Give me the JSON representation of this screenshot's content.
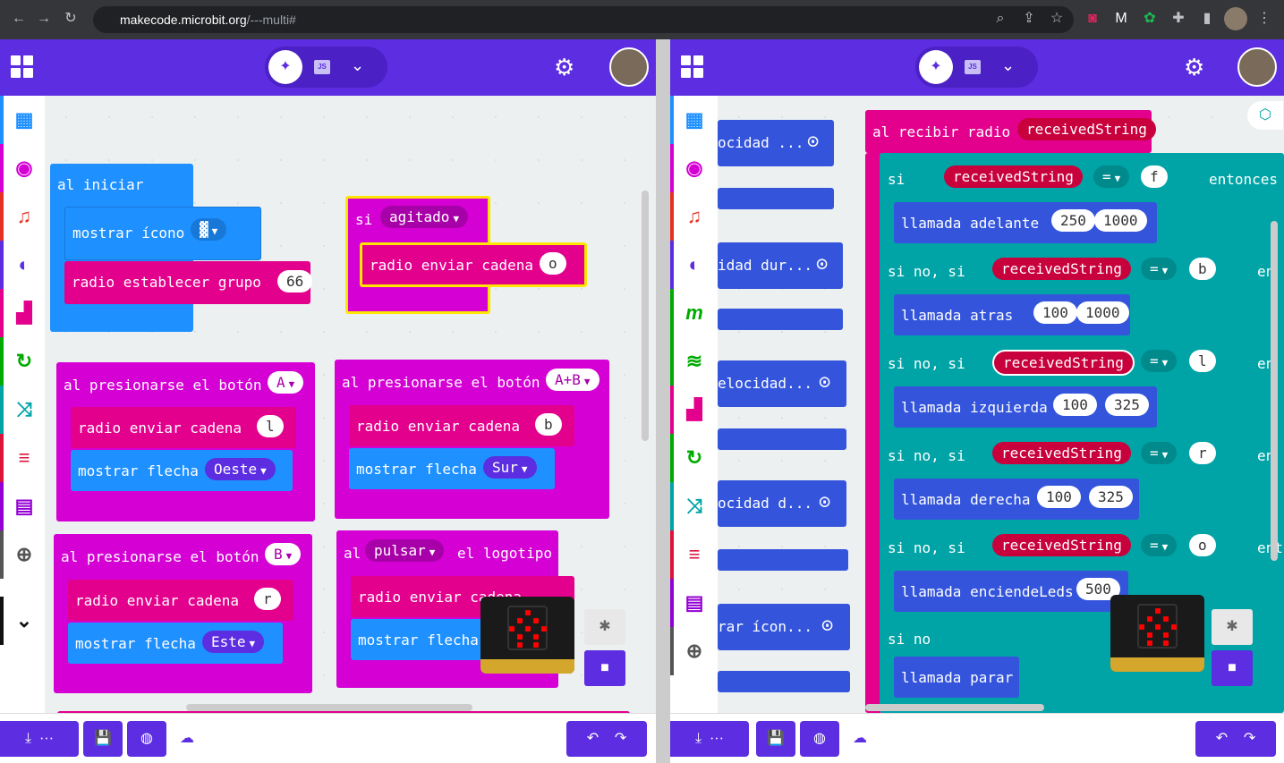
{
  "browser": {
    "url_host": "makecode.microbit.org",
    "url_path": "/---multi#"
  },
  "left": {
    "blocks": {
      "start": {
        "title": "al iniciar",
        "show_icon": "mostrar ícono",
        "set_group": "radio establecer grupo",
        "group": "66"
      },
      "shake": {
        "if": "si",
        "gesture": "agitado",
        "send": "radio enviar cadena",
        "value": "o"
      },
      "btnA": {
        "title": "al presionarse el botón",
        "button": "A",
        "send": "radio enviar cadena",
        "value": "l",
        "arrow": "mostrar flecha",
        "dir": "Oeste"
      },
      "btnAB": {
        "title": "al presionarse el botón",
        "button": "A+B",
        "send": "radio enviar cadena",
        "value": "b",
        "arrow": "mostrar flecha",
        "dir": "Sur"
      },
      "btnB": {
        "title": "al presionarse el botón",
        "button": "B",
        "send": "radio enviar cadena",
        "value": "r",
        "arrow": "mostrar flecha",
        "dir": "Este"
      },
      "logo": {
        "al": "al",
        "action": "pulsar",
        "logo": "el logotipo",
        "send": "radio enviar cadena",
        "arrow": "mostrar flecha"
      }
    }
  },
  "right": {
    "flyout": [
      "ocidad ...",
      "idad dur...",
      "elocidad...",
      "ocidad d...",
      "rar ícon..."
    ],
    "receive": {
      "title": "al recibir radio",
      "var": "receivedString",
      "si": "si",
      "sino_si": "si no, si",
      "sino": "si no",
      "entonces": "entonces",
      "eq": "=",
      "rows": [
        {
          "cond": "f",
          "call": "llamada adelante",
          "a": "250",
          "b": "1000"
        },
        {
          "cond": "b",
          "call": "llamada atras",
          "a": "100",
          "b": "1000"
        },
        {
          "cond": "l",
          "call": "llamada izquierda",
          "a": "100",
          "b": "325"
        },
        {
          "cond": "r",
          "call": "llamada derecha",
          "a": "100",
          "b": "325"
        },
        {
          "cond": "o",
          "call": "llamada enciendeLeds",
          "a": "500",
          "b": ""
        }
      ],
      "tail_en": "en",
      "tail_ent": "ent",
      "parar": "llamada parar"
    }
  },
  "colors": {
    "header": "#5c2de1",
    "radio": "#e3008c",
    "basic": "#1e90ff",
    "functions": "#3455db",
    "logic": "#00a4a6",
    "input": "#c724b1"
  }
}
